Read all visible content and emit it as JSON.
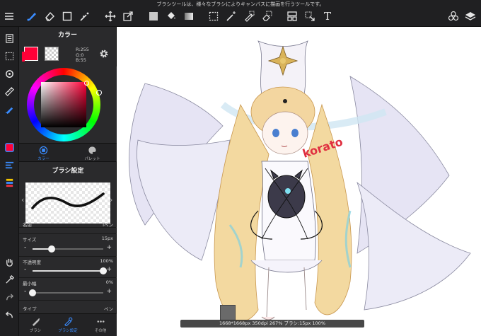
{
  "toolbar": {
    "hint": "ブラシツールは、様々なブラシによりキャンバスに描画を行うツールです。",
    "icons": [
      "menu-icon",
      "brush-icon",
      "eraser-icon",
      "rectangle-icon",
      "wand-icon",
      "move-icon",
      "transform-icon",
      "fill-color-icon",
      "bucket-icon",
      "gradient-icon",
      "select-rect-icon",
      "magic-wand-icon",
      "select-pen-icon",
      "select-eraser-icon",
      "frame-icon",
      "select-move-icon",
      "text-icon",
      "materials-icon",
      "layers-icon"
    ],
    "text_tool_glyph": "T"
  },
  "color_panel": {
    "title": "カラー",
    "rgb": {
      "r": "R:255",
      "g": "G:0",
      "b": "B:55"
    },
    "main_color": "#ff0037",
    "tabs": [
      {
        "label": "カラー",
        "active": true
      },
      {
        "label": "パレット",
        "active": false
      }
    ]
  },
  "brush_panel": {
    "title": "ブラシ設定",
    "name_label": "名前",
    "name_value": "Iペン",
    "size_label": "サイズ",
    "size_value": "15px",
    "size_level": 0.27,
    "opacity_label": "不透明度",
    "opacity_value": "100%",
    "opacity_level": 1.0,
    "min_width_label": "最小幅",
    "min_width_value": "0%",
    "min_width_level": 0.0,
    "type_label": "タイプ",
    "type_value": "ペン",
    "minus": "-",
    "plus": "+",
    "prev": "‹",
    "next": "›"
  },
  "bottom_tabs": [
    {
      "label": "ブラシ",
      "active": false
    },
    {
      "label": "ブラシ設定",
      "active": true
    },
    {
      "label": "その他",
      "active": false
    }
  ],
  "canvas": {
    "signature": "korato",
    "status": "1668*1668px 350dpi 267% ブラシ:15px 100%"
  }
}
